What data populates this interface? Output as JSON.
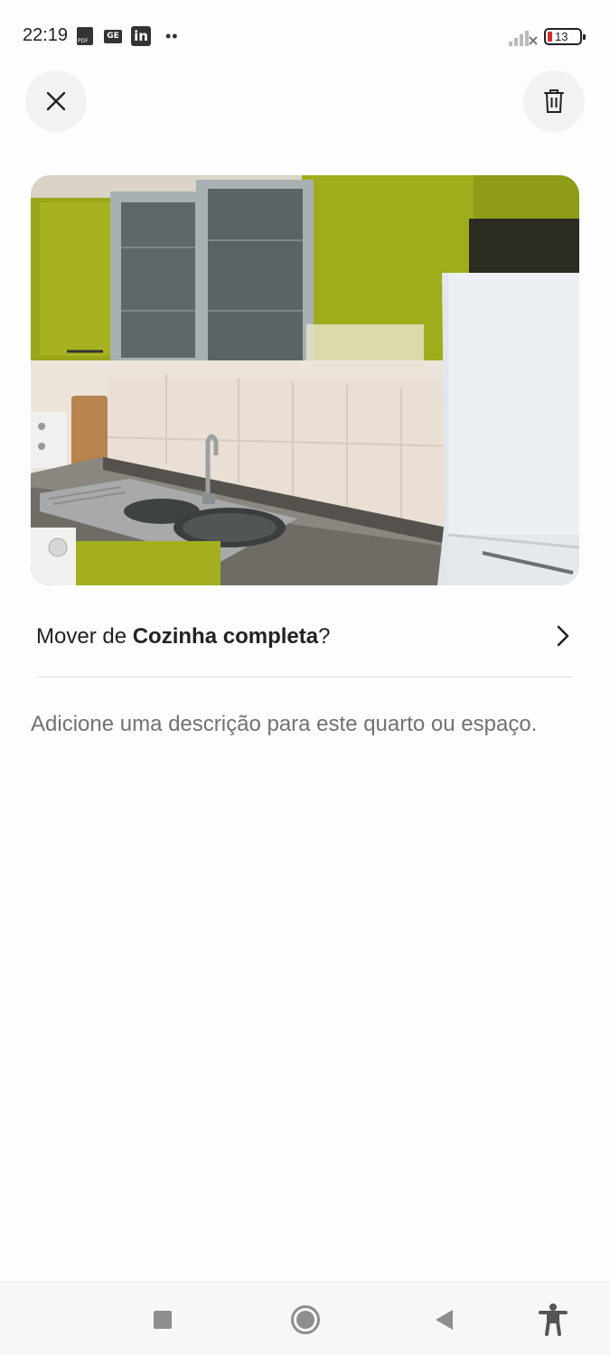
{
  "status_bar": {
    "time": "22:19",
    "notification_icons": [
      "pdf-icon",
      "ge-icon",
      "linkedin-icon",
      "more-dots-icon"
    ],
    "ge_text": "GE",
    "linkedin_text": "in",
    "dots": "••",
    "battery_level": "13",
    "battery_color": "#d32f2f"
  },
  "header": {
    "close_icon": "close-icon",
    "delete_icon": "trash-icon"
  },
  "photo": {
    "subject": "kitchen-photo"
  },
  "move_row": {
    "prefix": "Mover de ",
    "room_name": "Cozinha completa",
    "suffix": "?"
  },
  "description": {
    "placeholder": "Adicione uma descrição para este quarto ou espaço."
  },
  "nav_bar": {
    "icons": [
      "recents-square-icon",
      "home-circle-icon",
      "back-triangle-icon",
      "accessibility-icon"
    ]
  }
}
